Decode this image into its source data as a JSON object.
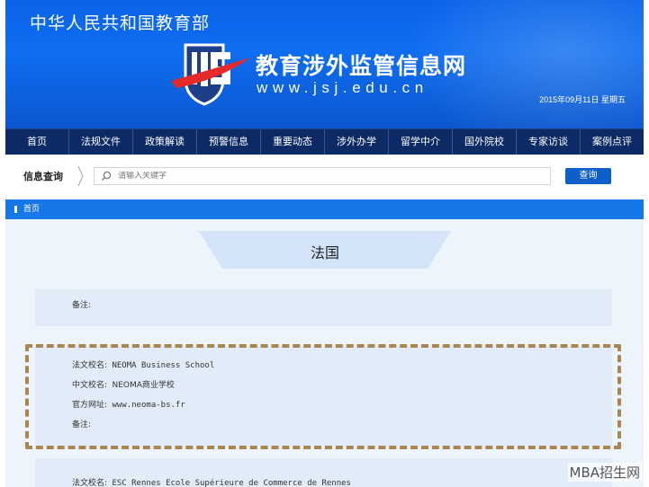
{
  "header": {
    "ministry": "中华人民共和国教育部",
    "site_name": "教育涉外监管信息网",
    "site_url": "www.jsj.edu.cn",
    "date": "2015年09月11日 星期五"
  },
  "nav": {
    "items": [
      "首页",
      "法规文件",
      "政策解读",
      "预警信息",
      "重要动态",
      "涉外办学",
      "留学中介",
      "国外院校",
      "专家访谈",
      "案例点评"
    ]
  },
  "search": {
    "label": "信息查询",
    "placeholder": "请输入关键字",
    "button_label": "查询"
  },
  "breadcrumb": {
    "home": "首页"
  },
  "page": {
    "country": "法国"
  },
  "cards": [
    {
      "note_label": "备注:"
    },
    {
      "fr_name_label": "法文校名:",
      "fr_name": "NEOMA Business School",
      "cn_name_label": "中文校名:",
      "cn_name": "NEOMA商业学校",
      "website_label": "官方网址:",
      "website": "www.neoma-bs.fr",
      "note_label": "备注:"
    },
    {
      "fr_name_label": "法文校名:",
      "fr_name": "ESC Rennes Ecole Supérieure de Commerce de Rennes"
    }
  ],
  "watermark": "MBA招生网",
  "colors": {
    "banner_blue": "#0e6df0",
    "nav_navy": "#0b2a66",
    "breadcrumb_blue": "#1677e8",
    "highlight_brown": "#a98552"
  }
}
